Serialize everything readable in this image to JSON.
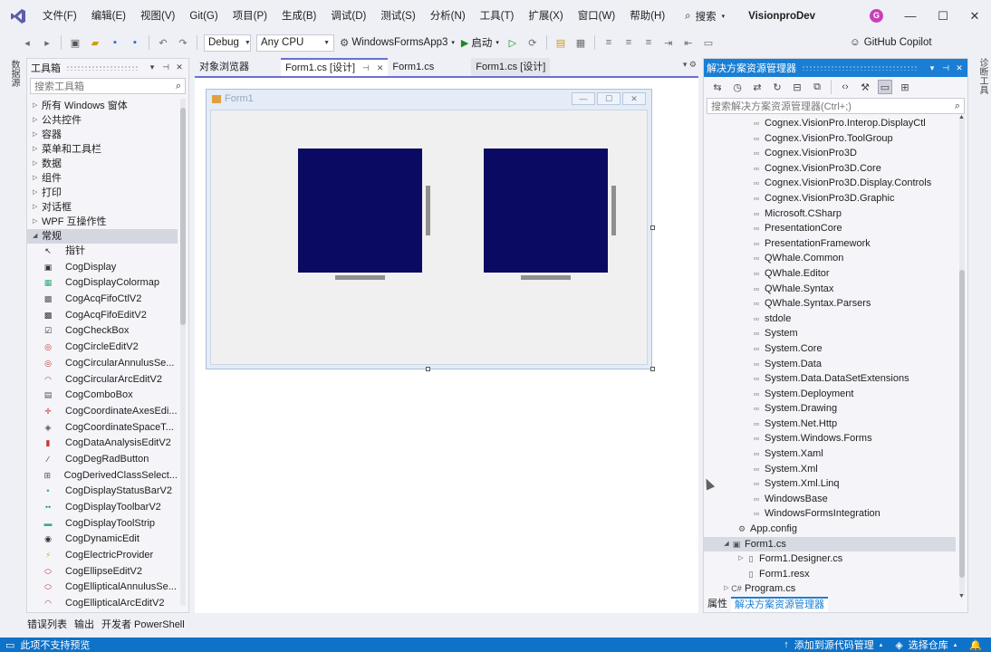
{
  "menu": [
    "文件(F)",
    "编辑(E)",
    "视图(V)",
    "Git(G)",
    "项目(P)",
    "生成(B)",
    "调试(D)",
    "测试(S)",
    "分析(N)",
    "工具(T)",
    "扩展(X)",
    "窗口(W)",
    "帮助(H)"
  ],
  "search_label": "搜索",
  "solution_name": "VisionproDev",
  "avatar_letter": "G",
  "toolbar": {
    "config": "Debug",
    "platform": "Any CPU",
    "startup_project": "WindowsFormsApp3",
    "start_label": "启动",
    "copilot": "GitHub Copilot"
  },
  "left_strip_label": "数据源",
  "right_strip_label": "诊断工具",
  "toolbox": {
    "title": "工具箱",
    "search_placeholder": "搜索工具箱",
    "categories": [
      "所有 Windows 窗体",
      "公共控件",
      "容器",
      "菜单和工具栏",
      "数据",
      "组件",
      "打印",
      "对话框",
      "WPF 互操作性"
    ],
    "open_category": "常规",
    "items": [
      {
        "label": "指针",
        "icon": "pointer-icon"
      },
      {
        "label": "CogDisplay",
        "icon": "cog-display-icon"
      },
      {
        "label": "CogDisplayColormap",
        "icon": "colormap-icon"
      },
      {
        "label": "CogAcqFifoCtlV2",
        "icon": "acq-fifo-icon"
      },
      {
        "label": "CogAcqFifoEditV2",
        "icon": "acq-fifo-edit-icon"
      },
      {
        "label": "CogCheckBox",
        "icon": "checkbox-icon"
      },
      {
        "label": "CogCircleEditV2",
        "icon": "circle-edit-icon"
      },
      {
        "label": "CogCircularAnnulusSe...",
        "icon": "annulus-icon"
      },
      {
        "label": "CogCircularArcEditV2",
        "icon": "arc-edit-icon"
      },
      {
        "label": "CogComboBox",
        "icon": "combobox-icon"
      },
      {
        "label": "CogCoordinateAxesEdi...",
        "icon": "axes-icon"
      },
      {
        "label": "CogCoordinateSpaceT...",
        "icon": "coordinate-space-icon"
      },
      {
        "label": "CogDataAnalysisEditV2",
        "icon": "data-analysis-icon"
      },
      {
        "label": "CogDegRadButton",
        "icon": "degrad-icon"
      },
      {
        "label": "CogDerivedClassSelect...",
        "icon": "derived-class-icon"
      },
      {
        "label": "CogDisplayStatusBarV2",
        "icon": "statusbar-icon"
      },
      {
        "label": "CogDisplayToolbarV2",
        "icon": "toolbar-icon"
      },
      {
        "label": "CogDisplayToolStrip",
        "icon": "toolstrip-icon"
      },
      {
        "label": "CogDynamicEdit",
        "icon": "dynamic-edit-icon"
      },
      {
        "label": "CogElectricProvider",
        "icon": "electric-icon"
      },
      {
        "label": "CogEllipseEditV2",
        "icon": "ellipse-edit-icon"
      },
      {
        "label": "CogEllipticalAnnulusSe...",
        "icon": "elliptical-annulus-icon"
      },
      {
        "label": "CogEllipticalArcEditV2",
        "icon": "elliptical-arc-icon"
      }
    ]
  },
  "doc_tabs": [
    {
      "label": "对象浏览器",
      "active": false
    },
    {
      "label": "Form1.cs [设计]",
      "active": true
    },
    {
      "label": "Form1.cs",
      "active": false
    },
    {
      "label": "Form1.cs [设计]",
      "active": false
    }
  ],
  "form_title": "Form1",
  "solution_explorer": {
    "title": "解决方案资源管理器",
    "search_placeholder": "搜索解决方案资源管理器(Ctrl+;)",
    "references": [
      "Cognex.VisionPro.Interop.DisplayCtl",
      "Cognex.VisionPro.ToolGroup",
      "Cognex.VisionPro3D",
      "Cognex.VisionPro3D.Core",
      "Cognex.VisionPro3D.Display.Controls",
      "Cognex.VisionPro3D.Graphic",
      "Microsoft.CSharp",
      "PresentationCore",
      "PresentationFramework",
      "QWhale.Common",
      "QWhale.Editor",
      "QWhale.Syntax",
      "QWhale.Syntax.Parsers",
      "stdole",
      "System",
      "System.Core",
      "System.Data",
      "System.Data.DataSetExtensions",
      "System.Deployment",
      "System.Drawing",
      "System.Net.Http",
      "System.Windows.Forms",
      "System.Xaml",
      "System.Xml",
      "System.Xml.Linq",
      "WindowsBase",
      "WindowsFormsIntegration"
    ],
    "app_config": "App.config",
    "form1": "Form1.cs",
    "form1_children": [
      "Form1.Designer.cs",
      "Form1.resx"
    ],
    "program": "Program.cs",
    "bottom_tabs": [
      "属性",
      "解决方案资源管理器"
    ]
  },
  "bottom_tabs": [
    "错误列表",
    "输出",
    "开发者 PowerShell"
  ],
  "status": {
    "left": "此项不支持预览",
    "source_control": "添加到源代码管理",
    "repo": "选择仓库"
  }
}
